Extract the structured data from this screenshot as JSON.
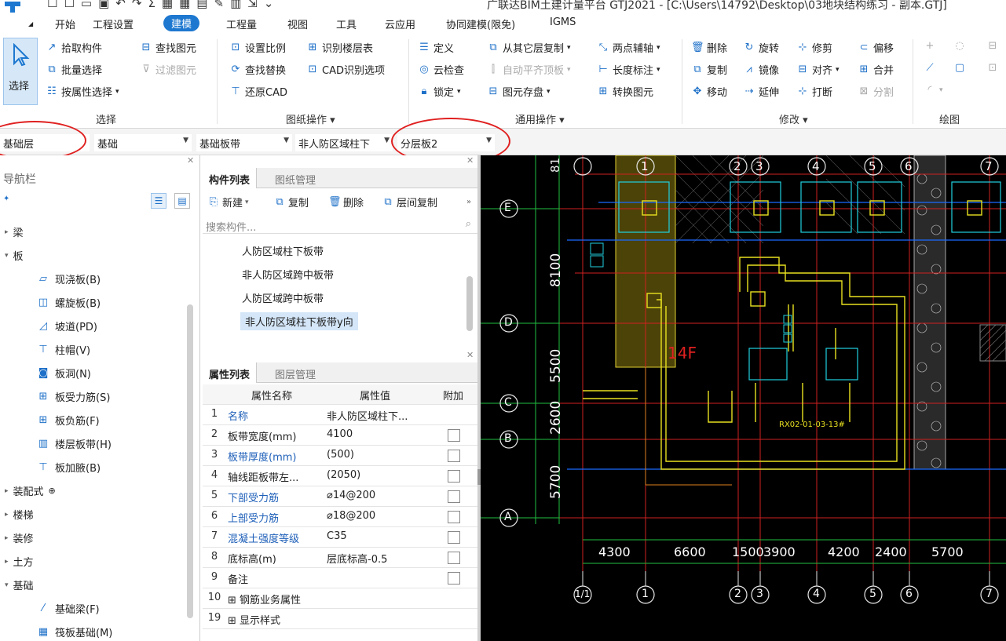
{
  "window": {
    "title": "广联达BIM土建计量平台 GTJ2021 - [C:\\Users\\14792\\Desktop\\03地块结构练习 - 副本.GTJ]"
  },
  "menu": {
    "items": [
      "开始",
      "工程设置",
      "建模",
      "工程量",
      "视图",
      "工具",
      "云应用",
      "协同建模(限免)",
      "IGMS"
    ],
    "active": "建模"
  },
  "ribbon": {
    "select": {
      "big": "选择",
      "pick": "拾取构件",
      "batch": "批量选择",
      "by_attr": "按属性选择",
      "find": "查找图元",
      "filter": "过滤图元",
      "label": "选择"
    },
    "drawing": {
      "scale": "设置比例",
      "identify_floor": "识别楼层表",
      "find_replace": "查找替换",
      "cad_options": "CAD识别选项",
      "restore_cad": "还原CAD",
      "label": "图纸操作"
    },
    "common": {
      "define": "定义",
      "copy_from_other": "从其它层复制",
      "two_point_axis": "两点辅轴",
      "cloud_check": "云检查",
      "auto_flat_top": "自动平齐顶板",
      "length_dim": "长度标注",
      "lock": "锁定",
      "save_element": "图元存盘",
      "convert_element": "转换图元",
      "label": "通用操作"
    },
    "modify": {
      "delete": "删除",
      "rotate": "旋转",
      "trim": "修剪",
      "offset": "偏移",
      "copy": "复制",
      "mirror": "镜像",
      "align": "对齐",
      "merge": "合并",
      "move": "移动",
      "extend": "延伸",
      "break": "打断",
      "split": "分割",
      "label": "修改"
    },
    "draw": {
      "label": "绘图"
    }
  },
  "filterbar": {
    "floor": "基础层",
    "category": "基础",
    "type": "基础板带",
    "component": "非人防区域柱下",
    "layer": "分层板2"
  },
  "nav": {
    "title": "导航栏",
    "items": [
      {
        "label": "梁",
        "expanded": false
      },
      {
        "label": "板",
        "expanded": true
      },
      {
        "label": "现浇板(B)",
        "icon": "cast-slab-icon"
      },
      {
        "label": "螺旋板(B)",
        "icon": "spiral-slab-icon"
      },
      {
        "label": "坡道(PD)",
        "icon": "ramp-icon"
      },
      {
        "label": "柱帽(V)",
        "icon": "column-cap-icon"
      },
      {
        "label": "板洞(N)",
        "icon": "slab-hole-icon"
      },
      {
        "label": "板受力筋(S)",
        "icon": "slab-main-rebar-icon"
      },
      {
        "label": "板负筋(F)",
        "icon": "slab-negative-rebar-icon"
      },
      {
        "label": "楼层板带(H)",
        "icon": "floor-slab-strip-icon"
      },
      {
        "label": "板加腋(B)",
        "icon": "slab-haunch-icon"
      },
      {
        "label": "装配式",
        "expanded": false
      },
      {
        "label": "楼梯",
        "expanded": false
      },
      {
        "label": "装修",
        "expanded": false
      },
      {
        "label": "土方",
        "expanded": false
      },
      {
        "label": "基础",
        "expanded": true
      },
      {
        "label": "基础梁(F)",
        "icon": "foundation-beam-icon"
      },
      {
        "label": "筏板基础(M)",
        "icon": "raft-foundation-icon"
      }
    ]
  },
  "components": {
    "tabs": [
      "构件列表",
      "图纸管理"
    ],
    "toolbar": {
      "new": "新建",
      "copy": "复制",
      "delete": "删除",
      "layer_copy": "层间复制"
    },
    "search_placeholder": "搜索构件...",
    "items": [
      "人防区域柱下板带",
      "非人防区域跨中板带",
      "人防区域跨中板带",
      "非人防区域柱下板带y向"
    ],
    "selected_index": 3
  },
  "properties": {
    "tabs": [
      "属性列表",
      "图层管理"
    ],
    "headers": {
      "name": "属性名称",
      "value": "属性值",
      "extra": "附加"
    },
    "rows": [
      {
        "num": "1",
        "name": "名称",
        "value": "非人防区域柱下...",
        "blue": true,
        "check": false
      },
      {
        "num": "2",
        "name": "板带宽度(mm)",
        "value": "4100",
        "blue": false,
        "check": true
      },
      {
        "num": "3",
        "name": "板带厚度(mm)",
        "value": "(500)",
        "blue": true,
        "check": true
      },
      {
        "num": "4",
        "name": "轴线距板带左...",
        "value": "(2050)",
        "blue": false,
        "check": true
      },
      {
        "num": "5",
        "name": "下部受力筋",
        "value": "⌀14@200",
        "blue": true,
        "check": true
      },
      {
        "num": "6",
        "name": "上部受力筋",
        "value": "⌀18@200",
        "blue": true,
        "check": true
      },
      {
        "num": "7",
        "name": "混凝土强度等级",
        "value": "C35",
        "blue": true,
        "check": true
      },
      {
        "num": "8",
        "name": "底标高(m)",
        "value": "层底标高-0.5",
        "blue": false,
        "check": true
      },
      {
        "num": "9",
        "name": "备注",
        "value": "",
        "blue": false,
        "check": true
      },
      {
        "num": "10",
        "name": "钢筋业务属性",
        "value": "",
        "blue": false,
        "check": false,
        "expand": true
      },
      {
        "num": "19",
        "name": "显示样式",
        "value": "",
        "blue": false,
        "check": false,
        "expand": true
      }
    ]
  },
  "cad": {
    "axes_top": [
      "1",
      "2",
      "3",
      "4",
      "5",
      "6",
      "7"
    ],
    "axes_bottom": [
      "1/1",
      "1",
      "2",
      "3",
      "4",
      "5",
      "6",
      "7"
    ],
    "axes_left": [
      "E",
      "D",
      "C",
      "B",
      "A"
    ],
    "dims_bottom": [
      "4300",
      "6600",
      "1500",
      "3900",
      "4200",
      "2400",
      "5700"
    ],
    "dims_left": [
      "8100",
      "5500",
      "2600",
      "5700"
    ],
    "top_left_text": "81",
    "zone_label": "14F",
    "block_label": "RX02-01-03-13#"
  },
  "colors": {
    "accent": "#1e78d0",
    "highlight": "#e02020"
  }
}
